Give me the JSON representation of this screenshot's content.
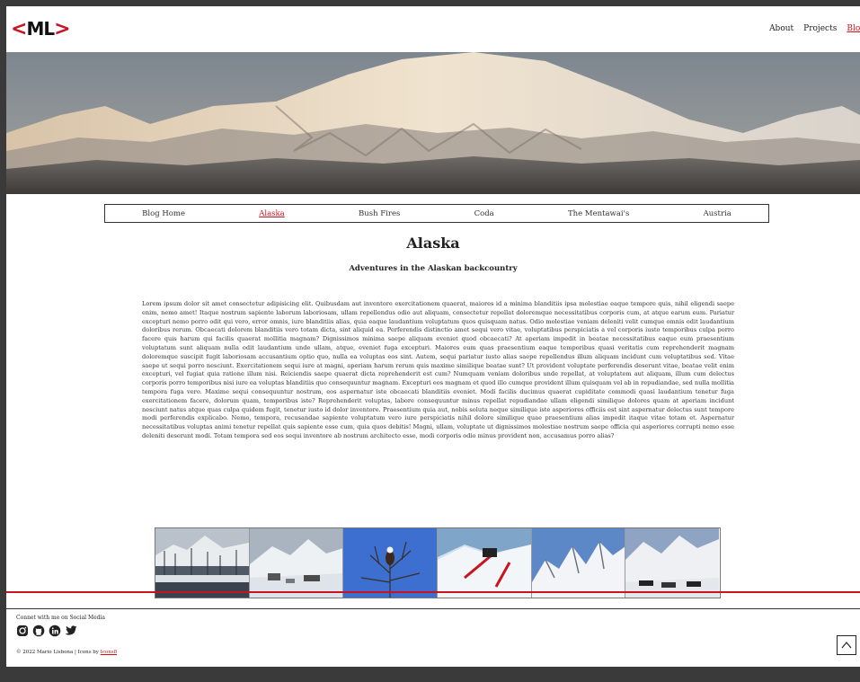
{
  "header": {
    "logo_left": "<",
    "logo_text": "ML",
    "logo_right": ">",
    "nav": [
      {
        "label": "About",
        "active": false
      },
      {
        "label": "Projects",
        "active": false
      },
      {
        "label": "Blog",
        "active": true
      }
    ]
  },
  "blog_nav": {
    "items": [
      {
        "label": "Blog Home",
        "active": false
      },
      {
        "label": "Alaska",
        "active": true
      },
      {
        "label": "Bush Fires",
        "active": false
      },
      {
        "label": "Coda",
        "active": false
      },
      {
        "label": "The Mentawai's",
        "active": false
      },
      {
        "label": "Austria",
        "active": false
      }
    ]
  },
  "article": {
    "title": "Alaska",
    "subtitle": "Adventures in the Alaskan backcountry",
    "body": "Lorem ipsum dolor sit amet consectetur adipisicing elit. Quibusdam aut inventore exercitationem quaerat, maiores id a minima blanditiis ipsa molestiae eaque tempore quis, nihil eligendi saepe enim, nemo amet! Itaque nostrum sapiente laborum laboriosam, ullam repellendus odio aut aliquam, consectetur repellat doloremque necessitatibus corporis cum, at atque earum eum. Pariatur excepturi nemo porro odit qui vero, error omnis, iure blanditiis alias, quia eaque laudantium voluptatum quos quisquam natus. Odio molestiae veniam deleniti velit cumque omnis odit laudantium doloribus rerum. Obcaecati dolorem blanditiis vero totam dicta, sint aliquid ea. Perferendis distinctio amet sequi vero vitae, voluptatibus perspiciatis a vel corporis iusto temporibus culpa porro facere quis harum qui facilis quaerat mollitia magnam? Dignissimos minima saepe aliquam eveniet quod obcaecati? At aperiam impedit in beatae necessitatibus eaque eum praesentium voluptatum sunt aliquam nulla odit laudantium unde ullam, atque, eveniet fuga excepturi. Maiores eum quas praesentium eaque temporibus quasi veritatis cum reprehenderit magnam doloremque suscipit fugit laboriosam accusantium optio quo, nulla ea voluptas eos sint. Autem, sequi pariatur iusto alias saepe repellendus illum aliquam incidunt cum voluptatibus sed. Vitae saepe ut sequi porro nesciunt. Exercitationem sequi iure at magni, aperiam harum rerum quis maxime similique beatae sunt? Ut provident voluptate perferendis deserunt vitae, beatae velit enim excepturi, vel fugiat quia ratione illum nisi. Reiciendis saepe quaerat dicta reprehenderit est cum? Numquam veniam doloribus unde repellat, at voluptatem aut aliquam, illum cum delectus corporis porro temporibus nisi iure ea voluptas blanditiis quo consequuntur magnam. Excepturi eos magnam et quod illo cumque provident illum quisquam vel ab in repudiandae, sed nulla mollitia tempora fuga vero. Maxime sequi consequuntur nostrum, eos aspernatur iste obcaecati blanditiis eveniet. Modi facilis ducimus quaerat cupiditate commodi quasi laudantium tenetur fuga exercitationem facere, dolorum quam, temporibus iste? Reprehenderit voluptas, labore consequuntur minus repellat repudiandae ullam eligendi similique dolores quam at aperiam incidunt nesciunt natus atque quas culpa quidem fugit, tenetur iusto id dolor inventore. Praesentium quia aut, nobis soluta neque similique iste asperiores officiis est sint aspernatur delectus sunt tempore modi perferendis explicabo. Nemo, tempora, recusandae sapiente voluptatum vero iure perspiciatis nihil dolore similique quae praesentium alias impedit itaque vitae totam et. Aspernatur necessitatibus voluptas animi tenetur repellat quis sapiente esse cum, quia quos debitis! Magni, ullam, voluptate ut dignissimos molestiae nostrum saepe officia qui asperiores corrupti nemo esse deleniti deserunt modi. Totam tempora sed eos sequi inventore ab nostrum architecto esse, modi corporis odio minus provident non, accusamus porro alias?"
  },
  "gallery": {
    "images": [
      {
        "subject": "harbor-boats"
      },
      {
        "subject": "snowy-mountain-camp"
      },
      {
        "subject": "bald-eagle-tree"
      },
      {
        "subject": "ski-descent"
      },
      {
        "subject": "snowy-peaks"
      },
      {
        "subject": "snowmobiles"
      }
    ]
  },
  "footer": {
    "social_label": "Connet with me on Social Media",
    "icons": [
      "instagram-icon",
      "github-icon",
      "linkedin-icon",
      "twitter-icon"
    ],
    "copyright_prefix": "© 2022 Mario Lisbona | Icons by ",
    "icons_link": "Icons8"
  },
  "colors": {
    "accent": "#c8141e",
    "background_outer": "#3a3a3a",
    "page": "#ffffff",
    "text": "#222222"
  }
}
